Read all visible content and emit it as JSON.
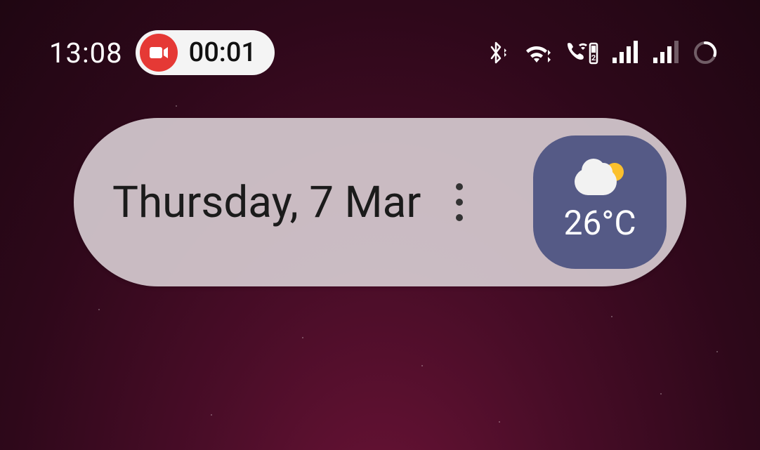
{
  "status": {
    "clock": "13:08",
    "recording_elapsed": "00:01"
  },
  "widget": {
    "date": "Thursday, 7 Mar",
    "weather": {
      "temp": "26°C"
    }
  }
}
